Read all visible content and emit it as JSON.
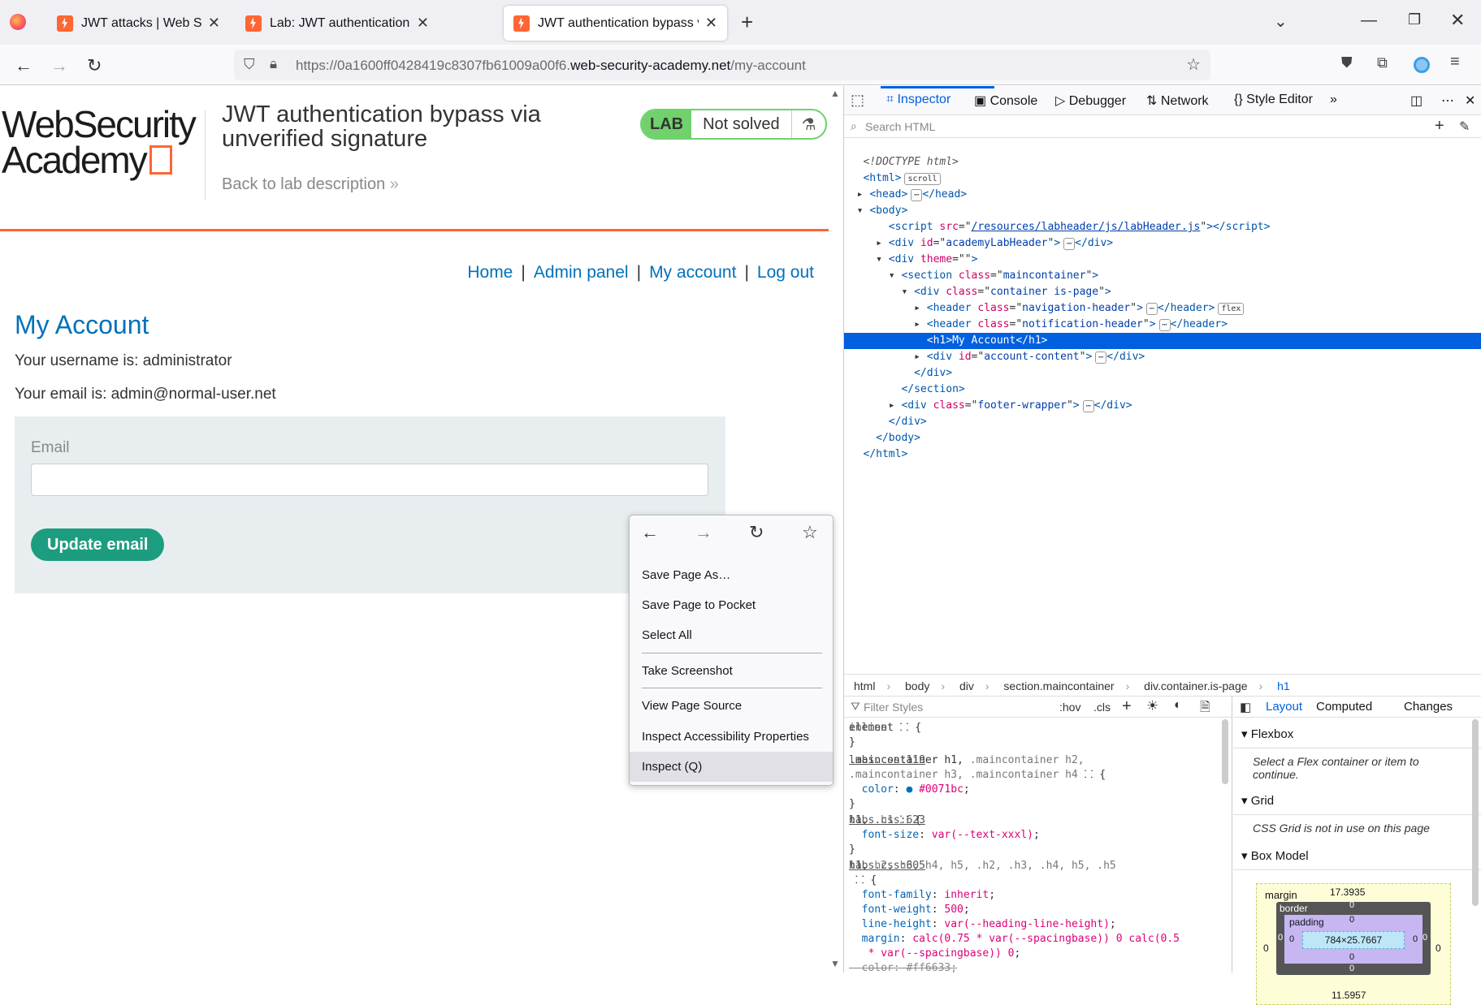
{
  "browser": {
    "tabs": [
      {
        "label": "JWT attacks | Web Security Acad",
        "active": false
      },
      {
        "label": "Lab: JWT authentication bypass",
        "active": false
      },
      {
        "label": "JWT authentication bypass via u",
        "active": true
      }
    ],
    "new_tab": "+",
    "url_prefix": "https://0a1600ff0428419c8307fb61009a00f6.",
    "url_host": "web-security-academy.net",
    "url_path": "/my-account"
  },
  "page": {
    "logo_line1": "WebSecurity",
    "logo_line2": "Academy",
    "lab_title": "JWT authentication bypass via unverified signature",
    "back_link": "Back to lab description",
    "badge_lab": "LAB",
    "badge_status": "Not solved",
    "nav": [
      "Home",
      "Admin panel",
      "My account",
      "Log out"
    ],
    "heading": "My Account",
    "username_line": "Your username is: administrator",
    "email_line": "Your email is: admin@normal-user.net",
    "email_label": "Email",
    "email_value": "",
    "update_button": "Update email"
  },
  "context_menu": {
    "items": [
      "Save Page As…",
      "Save Page to Pocket",
      "Select All",
      "Take Screenshot",
      "View Page Source",
      "Inspect Accessibility Properties",
      "Inspect (Q)"
    ]
  },
  "devtools": {
    "tabs": [
      "Inspector",
      "Console",
      "Debugger",
      "Network",
      "Style Editor"
    ],
    "search_placeholder": "Search HTML",
    "breadcrumbs": [
      "html",
      "body",
      "div",
      "section.maincontainer",
      "div.container.is-page",
      "h1"
    ],
    "filter_placeholder": "Filter Styles",
    "hov": ":hov",
    "cls": ".cls",
    "layout_tabs": [
      "Layout",
      "Computed",
      "Changes"
    ],
    "flexbox_title": "Flexbox",
    "flexbox_note": "Select a Flex container or item to continue.",
    "grid_title": "Grid",
    "grid_note": "CSS Grid is not in use on this page",
    "boxmodel_title": "Box Model",
    "box": {
      "margin_label": "margin",
      "margin_top": "17.3935",
      "margin_bottom": "11.5957",
      "border_label": "border",
      "padding_label": "padding",
      "content": "784×25.7667",
      "zero": "0"
    },
    "rule_sources": [
      "inline",
      "labs.css:119",
      "labs.css:623",
      "labs.css:605",
      "labs.css:132"
    ],
    "accent_color": "#0060df"
  }
}
